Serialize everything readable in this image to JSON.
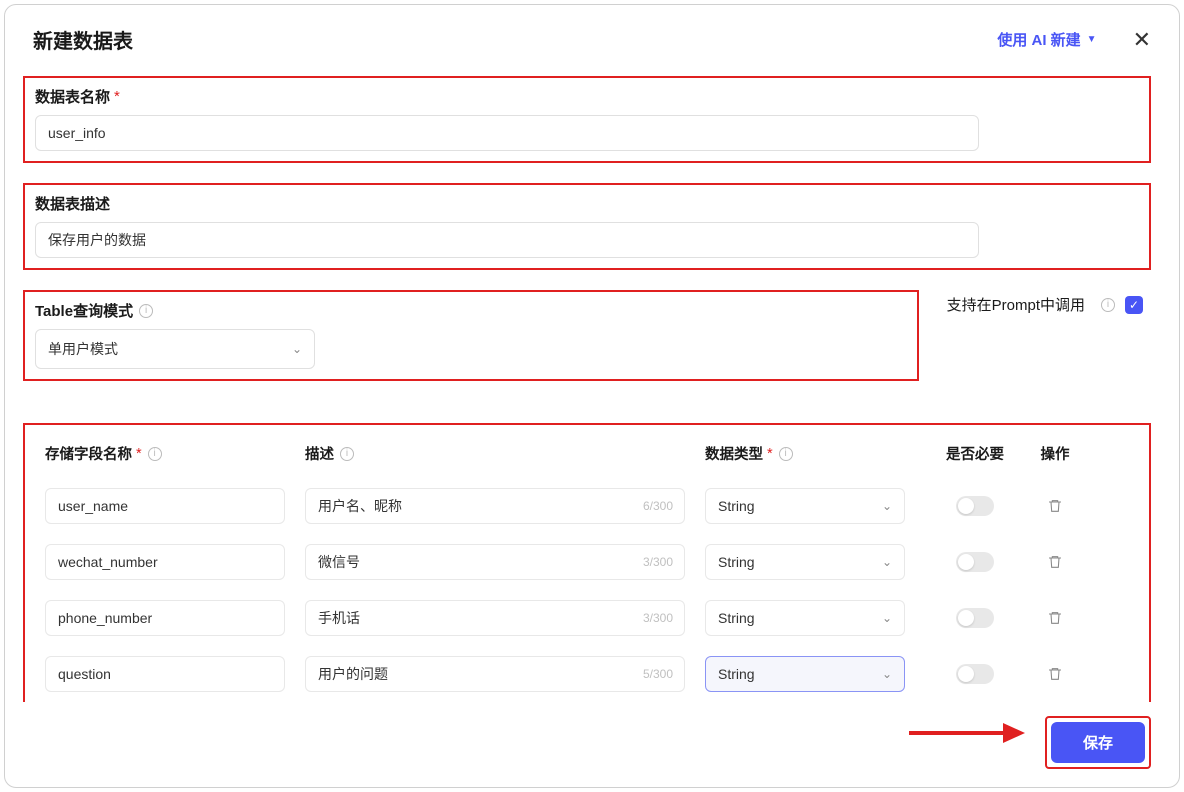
{
  "header": {
    "title": "新建数据表",
    "ai_link": "使用 AI 新建",
    "close": "✕"
  },
  "form": {
    "name_label": "数据表名称",
    "name_value": "user_info",
    "desc_label": "数据表描述",
    "desc_value": "保存用户的数据",
    "query_label": "Table查询模式",
    "query_value": "单用户模式",
    "prompt_label": "支持在Prompt中调用"
  },
  "fields_header": {
    "name": "存储字段名称",
    "desc": "描述",
    "type": "数据类型",
    "required": "是否必要",
    "op": "操作"
  },
  "desc_max": "300",
  "fields": [
    {
      "name": "user_name",
      "desc": "用户名、昵称",
      "count": "6",
      "type": "String",
      "active": false
    },
    {
      "name": "wechat_number",
      "desc": "微信号",
      "count": "3",
      "type": "String",
      "active": false
    },
    {
      "name": "phone_number",
      "desc": "手机话",
      "count": "3",
      "type": "String",
      "active": false
    },
    {
      "name": "question",
      "desc": "用户的问题",
      "count": "5",
      "type": "String",
      "active": true
    }
  ],
  "footer": {
    "save": "保存"
  }
}
